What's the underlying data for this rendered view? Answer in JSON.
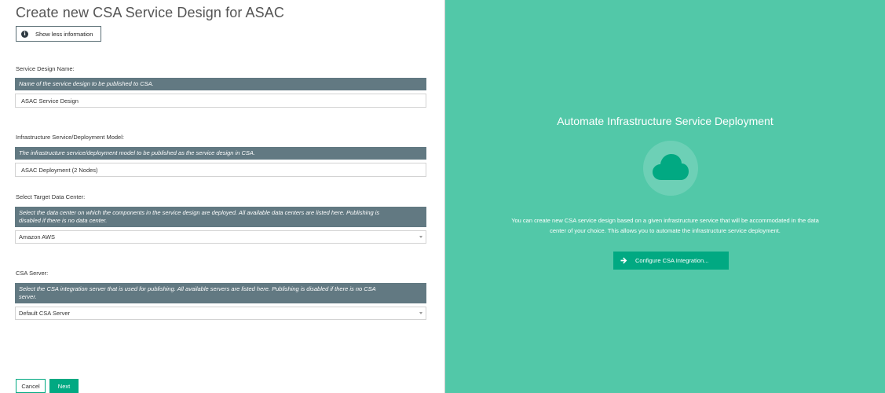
{
  "form": {
    "title": "Create new CSA Service Design for ASAC",
    "info_button_label": "Show less information",
    "info_icon_glyph": "i",
    "service_design_name": {
      "label": "Service Design Name:",
      "hint": "Name of the service design to be published to CSA.",
      "value": "ASAC Service Design"
    },
    "infrastructure_service": {
      "label": "Infrastructure Service/Deployment Model:",
      "hint": "The infrastructure service/deployment model to be published as the service design in CSA.",
      "value": "ASAC Deployment (2 Nodes)"
    },
    "target_data_center": {
      "label": "Select Target Data Center:",
      "hint_line1": "Select the data center on which the components in the service design are deployed. All available data centers are listed here. Publishing is",
      "hint_line2": "disabled if there is no data center.",
      "selected": "Amazon AWS"
    },
    "csa_server": {
      "label": "CSA Server:",
      "hint_line1": "Select the CSA integration server that is used for publishing. All available servers are listed here. Publishing is disabled if there is no CSA",
      "hint_line2": "server.",
      "selected": "Default CSA Server"
    },
    "cancel_label": "Cancel",
    "next_label": "Next"
  },
  "promo": {
    "title": "Automate Infrastructure Service Deployment",
    "icon": "cloud-icon",
    "text_line1": "You can create new CSA service design based on a given infrastructure service that will be accommodated in the data",
    "text_line2": "center of your choice. This allows you to automate the infrastructure service deployment.",
    "button_label": "Configure CSA Integration..."
  },
  "colors": {
    "accent": "#01a982",
    "panel_background": "#52c8a8",
    "hint_background": "#627982"
  }
}
